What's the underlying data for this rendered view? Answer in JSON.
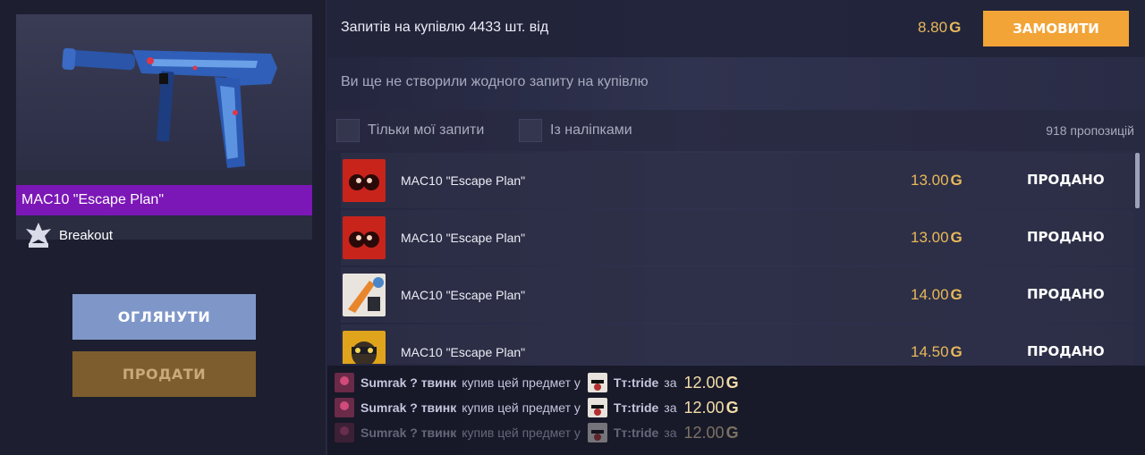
{
  "item": {
    "name": "MAC10 \"Escape Plan\"",
    "collection": "Breakout",
    "rarity_color": "#7b17b6"
  },
  "buttons": {
    "view": "ОГЛЯНУТИ",
    "sell": "ПРОДАТИ",
    "order": "ЗАМОВИТИ"
  },
  "request": {
    "text": "Запитів на купівлю 4433 шт. від",
    "price": "8.80",
    "none_text": "Ви ще не створили жодного запиту на купівлю"
  },
  "filters": {
    "only_mine": "Тільки мої запити",
    "with_stickers": "Із наліпками",
    "offers_count": "918 пропозицій"
  },
  "currency_icon": "gold-icon",
  "listings": [
    {
      "name": "MAC10 \"Escape Plan\"",
      "price": "13.00",
      "status": "ПРОДАНО",
      "avatar": "red-dragon-avatar"
    },
    {
      "name": "MAC10 \"Escape Plan\"",
      "price": "13.00",
      "status": "ПРОДАНО",
      "avatar": "red-dragon-avatar"
    },
    {
      "name": "MAC10 \"Escape Plan\"",
      "price": "14.00",
      "status": "ПРОДАНО",
      "avatar": "knife-avatar"
    },
    {
      "name": "MAC10 \"Escape Plan\"",
      "price": "14.50",
      "status": "ПРОДАНО",
      "avatar": "masked-avatar"
    }
  ],
  "feed": [
    {
      "buyer": "Sumrak ? твинк",
      "text": "купив цей предмет у",
      "seller": "Tт:tride",
      "for": "за",
      "price": "12.00"
    },
    {
      "buyer": "Sumrak ? твинк",
      "text": "купив цей предмет у",
      "seller": "Tт:tride",
      "for": "за",
      "price": "12.00"
    },
    {
      "buyer": "Sumrak ? твинк",
      "text": "купив цей предмет у",
      "seller": "Tт:tride",
      "for": "за",
      "price": "12.00"
    }
  ],
  "colors": {
    "accent_orange": "#f2a437",
    "gold_text": "#e8b85a",
    "view_button": "#7f97c8",
    "sell_button": "#7d5d2e"
  }
}
